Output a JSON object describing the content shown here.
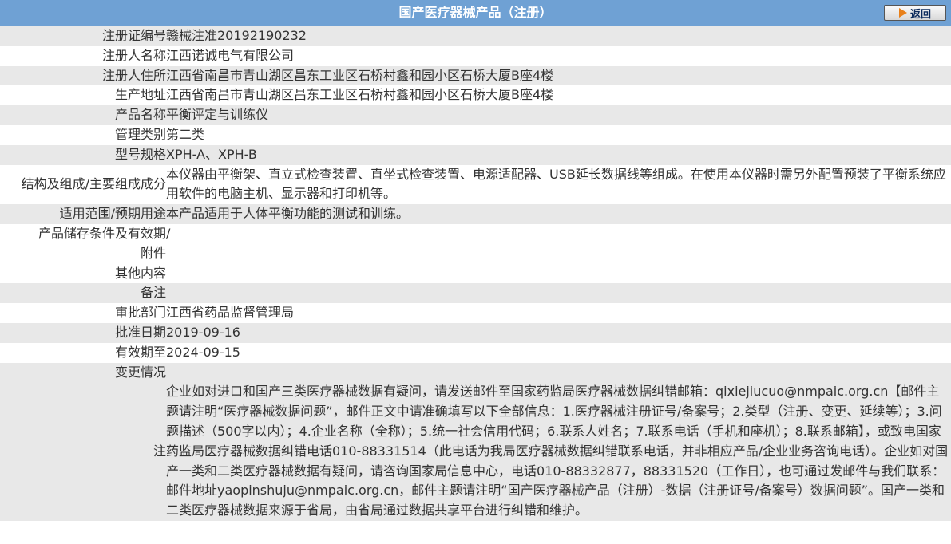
{
  "header": {
    "title": "国产医疗器械产品（注册）",
    "back_label": "返回"
  },
  "fields": {
    "reg_no": {
      "label": "注册证编号",
      "value": "赣械注准20192190232"
    },
    "registrant": {
      "label": "注册人名称",
      "value": "江西诺诚电气有限公司"
    },
    "registrant_address": {
      "label": "注册人住所",
      "value": "江西省南昌市青山湖区昌东工业区石桥村鑫和园小区石桥大厦B座4楼"
    },
    "production_address": {
      "label": "生产地址",
      "value": "江西省南昌市青山湖区昌东工业区石桥村鑫和园小区石桥大厦B座4楼"
    },
    "product_name": {
      "label": "产品名称",
      "value": "平衡评定与训练仪"
    },
    "category": {
      "label": "管理类别",
      "value": "第二类"
    },
    "model": {
      "label": "型号规格",
      "value": "XPH-A、XPH-B"
    },
    "structure": {
      "label": "结构及组成/主要组成成分",
      "value": "本仪器由平衡架、直立式检查装置、直坐式检查装置、电源适配器、USB延长数据线等组成。在使用本仪器时需另外配置预装了平衡系统应用软件的电脑主机、显示器和打印机等。"
    },
    "scope": {
      "label": "适用范围/预期用途",
      "value": "本产品适用于人体平衡功能的测试和训练。"
    },
    "storage": {
      "label": "产品储存条件及有效期",
      "value": "/"
    },
    "attachment": {
      "label": "附件",
      "value": ""
    },
    "other": {
      "label": "其他内容",
      "value": ""
    },
    "remark": {
      "label": "备注",
      "value": ""
    },
    "approval_dept": {
      "label": "审批部门",
      "value": "江西省药品监督管理局"
    },
    "approval_date": {
      "label": "批准日期",
      "value": "2019-09-16"
    },
    "valid_until": {
      "label": "有效期至",
      "value": "2024-09-15"
    },
    "changes": {
      "label": "变更情况",
      "value": ""
    },
    "note": {
      "label": "注",
      "value": "企业如对进口和国产三类医疗器械数据有疑问，请发送邮件至国家药监局医疗器械数据纠错邮箱：qixiejiucuo@nmpaic.org.cn【邮件主题请注明“医疗器械数据问题”，邮件正文中请准确填写以下全部信息：1.医疗器械注册证号/备案号；2.类型（注册、变更、延续等）；3.问题描述（500字以内）；4.企业名称（全称）；5.统一社会信用代码；6.联系人姓名；7.联系电话（手机和座机）；8.联系邮箱】，或致电国家药监局医疗器械数据纠错电话010-88331514（此电话为我局医疗器械数据纠错联系电话，并非相应产品/企业业务咨询电话）。企业如对国产一类和二类医疗器械数据有疑问，请咨询国家局信息中心，电话010-88332877，88331520（工作日），也可通过发邮件与我们联系：邮件地址yaopinshuju@nmpaic.org.cn，邮件主题请注明“国产医疗器械产品（注册）-数据（注册证号/备案号）数据问题”。国产一类和二类医疗器械数据来源于省局，由省局通过数据共享平台进行纠错和维护。"
    }
  }
}
